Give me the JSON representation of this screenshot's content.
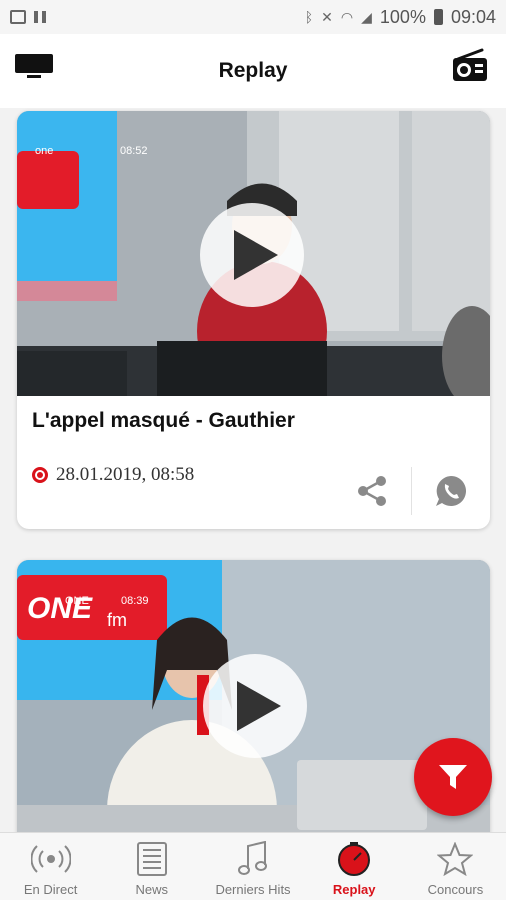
{
  "status_bar": {
    "battery_percent": "100%",
    "time": "09:04"
  },
  "header": {
    "title": "Replay",
    "left_icon": "tv-icon",
    "right_icon": "radio-icon"
  },
  "cards": [
    {
      "thumb_overlay_brand": "one",
      "thumb_overlay_time": "08:52",
      "title": "L'appel masqué - Gauthier",
      "datetime": "28.01.2019, 08:58"
    },
    {
      "thumb_overlay_brand": "ONE",
      "thumb_overlay_time": "08:39"
    }
  ],
  "tabs": [
    {
      "label": "En Direct",
      "icon": "broadcast-icon",
      "active": false
    },
    {
      "label": "News",
      "icon": "newspaper-icon",
      "active": false
    },
    {
      "label": "Derniers Hits",
      "icon": "music-note-icon",
      "active": false
    },
    {
      "label": "Replay",
      "icon": "replay-timer-icon",
      "active": true
    },
    {
      "label": "Concours",
      "icon": "star-icon",
      "active": false
    }
  ],
  "colors": {
    "accent": "#d9121a",
    "fab": "#e0151d",
    "screen_blue": "#34b4ee"
  }
}
